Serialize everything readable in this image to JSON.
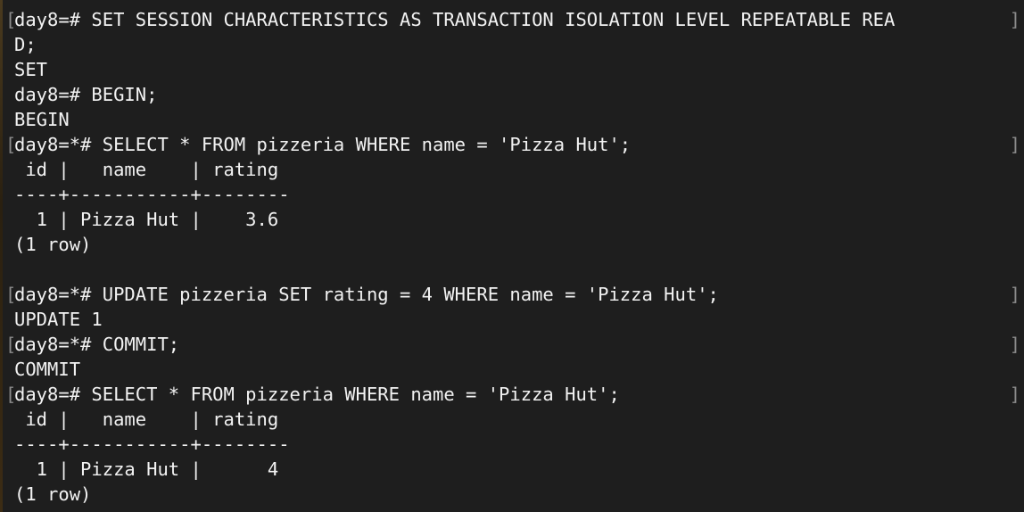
{
  "terminal": {
    "lines": [
      {
        "text": "day8=# SET SESSION CHARACTERISTICS AS TRANSACTION ISOLATION LEVEL REPEATABLE REA",
        "mark_open": "[",
        "mark_close": "]"
      },
      {
        "text": "D;",
        "mark_open": "",
        "mark_close": ""
      },
      {
        "text": "SET",
        "mark_open": "",
        "mark_close": ""
      },
      {
        "text": "day8=# BEGIN;",
        "mark_open": "",
        "mark_close": ""
      },
      {
        "text": "BEGIN",
        "mark_open": "",
        "mark_close": ""
      },
      {
        "text": "day8=*# SELECT * FROM pizzeria WHERE name = 'Pizza Hut';",
        "mark_open": "[",
        "mark_close": "]"
      },
      {
        "text": " id |   name    | rating",
        "mark_open": "",
        "mark_close": ""
      },
      {
        "text": "----+-----------+--------",
        "mark_open": "",
        "mark_close": ""
      },
      {
        "text": "  1 | Pizza Hut |    3.6",
        "mark_open": "",
        "mark_close": ""
      },
      {
        "text": "(1 row)",
        "mark_open": "",
        "mark_close": ""
      },
      {
        "text": "",
        "mark_open": "",
        "mark_close": ""
      },
      {
        "text": "day8=*# UPDATE pizzeria SET rating = 4 WHERE name = 'Pizza Hut';",
        "mark_open": "[",
        "mark_close": "]"
      },
      {
        "text": "UPDATE 1",
        "mark_open": "",
        "mark_close": ""
      },
      {
        "text": "day8=*# COMMIT;",
        "mark_open": "[",
        "mark_close": "]"
      },
      {
        "text": "COMMIT",
        "mark_open": "",
        "mark_close": ""
      },
      {
        "text": "day8=# SELECT * FROM pizzeria WHERE name = 'Pizza Hut';",
        "mark_open": "[",
        "mark_close": "]"
      },
      {
        "text": " id |   name    | rating",
        "mark_open": "",
        "mark_close": ""
      },
      {
        "text": "----+-----------+--------",
        "mark_open": "",
        "mark_close": ""
      },
      {
        "text": "  1 | Pizza Hut |      4",
        "mark_open": "",
        "mark_close": ""
      },
      {
        "text": "(1 row)",
        "mark_open": "",
        "mark_close": ""
      }
    ]
  },
  "colors": {
    "background": "#1e1e1e",
    "text": "#f2f2f2",
    "bracket": "#8c8c8c"
  }
}
